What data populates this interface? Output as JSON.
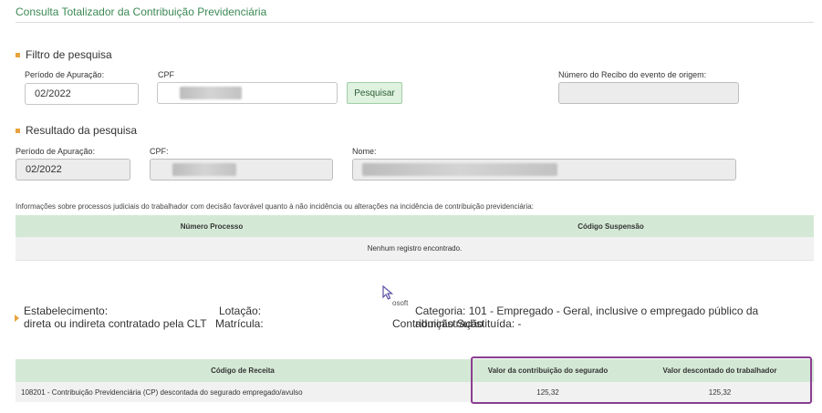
{
  "page": {
    "title": "Consulta Totalizador da Contribuição Previdenciária"
  },
  "filter": {
    "heading": "Filtro de pesquisa",
    "periodo_label": "Período de Apuração:",
    "periodo_value": "02/2022",
    "cpf_label": "CPF",
    "search_button": "Pesquisar",
    "recibo_label": "Número do Recibo do evento de origem:"
  },
  "result": {
    "heading": "Resultado da pesquisa",
    "periodo_label": "Período de Apuração:",
    "periodo_value": "02/2022",
    "cpf_label": "CPF:",
    "nome_label": "Nome:"
  },
  "judicial": {
    "info": "Informações sobre processos judiciais do trabalhador com decisão favorável quanto à não incidência ou alterações na incidência de contribuição previdenciária:",
    "columns": [
      "Número Processo",
      "Código Suspensão"
    ],
    "empty_message": "Nenhum registro encontrado."
  },
  "establishment": {
    "estabelecimento_label": "Estabelecimento:",
    "lotacao_label": "Lotação:",
    "categoria_text": "Categoria: 101 - Empregado - Geral, inclusive o empregado público da administração",
    "categoria_cont": "direta ou indireta contratado pela CLT",
    "matricula_label": "Matrícula:",
    "substituida_label": "Contribuição Substituída: -",
    "ghost_text": "osoft"
  },
  "revenue": {
    "columns": [
      "Código de Receita",
      "Valor da contribuição do segurado",
      "Valor descontado do trabalhador"
    ],
    "rows": [
      {
        "codigo": "108201 - Contribuição Previdenciária (CP) descontada do segurado empregado/avulso",
        "valor_segurado": "125,32",
        "valor_descontado": "125,32"
      }
    ]
  },
  "colors": {
    "accent": "#3c8a55",
    "header_green": "#d4e9d5",
    "bullet": "#e8a33d",
    "highlight": "#8b3f92"
  }
}
